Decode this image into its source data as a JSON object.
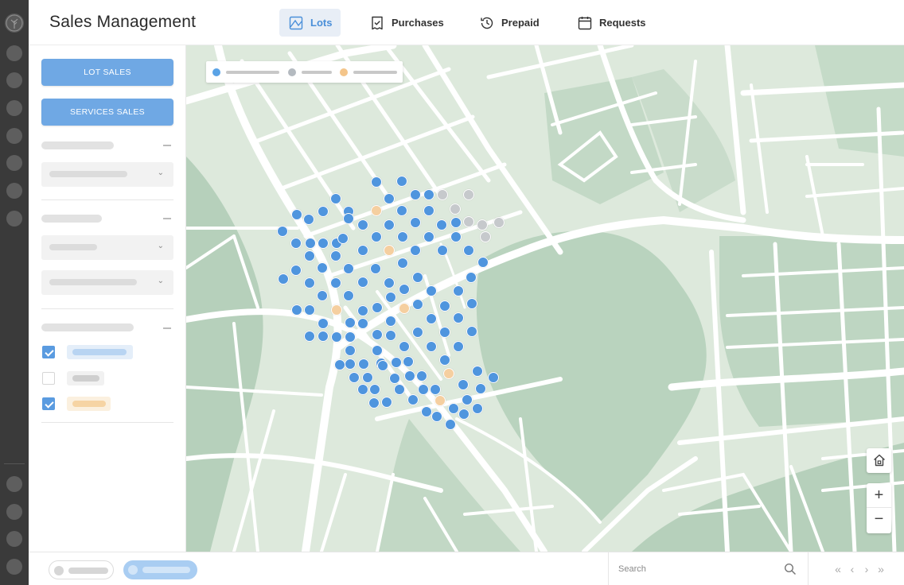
{
  "header": {
    "title": "Sales Management",
    "tabs": [
      {
        "label": "Lots",
        "icon": "map-icon",
        "active": true
      },
      {
        "label": "Purchases",
        "icon": "receipt-check-icon",
        "active": false
      },
      {
        "label": "Prepaid",
        "icon": "clock-history-icon",
        "active": false
      },
      {
        "label": "Requests",
        "icon": "calendar-icon",
        "active": false
      }
    ]
  },
  "sidebar": {
    "lot_sales_label": "LOT SALES",
    "services_sales_label": "SERVICES SALES",
    "checkboxes": [
      {
        "checked": true,
        "color": "#d4e5f8",
        "bar": "#b8d4f2"
      },
      {
        "checked": false,
        "color": "#f1f1f1",
        "bar": "#cfcfcf"
      },
      {
        "checked": true,
        "color": "#fbefdc",
        "bar": "#f6d4a4"
      }
    ]
  },
  "map": {
    "legend_colors": [
      "#5aa3e6",
      "#b4bac0",
      "#f4c58a"
    ],
    "pin_colors": {
      "available": "#4f95de",
      "unavailable": "#c6c9cc",
      "reserved": "#f5cfa0"
    },
    "zoom_in": "+",
    "zoom_out": "−",
    "home_icon": "home-icon"
  },
  "footer": {
    "search_placeholder": "Search",
    "pager": {
      "first": "«",
      "prev": "‹",
      "next": "›",
      "last": "»"
    }
  }
}
